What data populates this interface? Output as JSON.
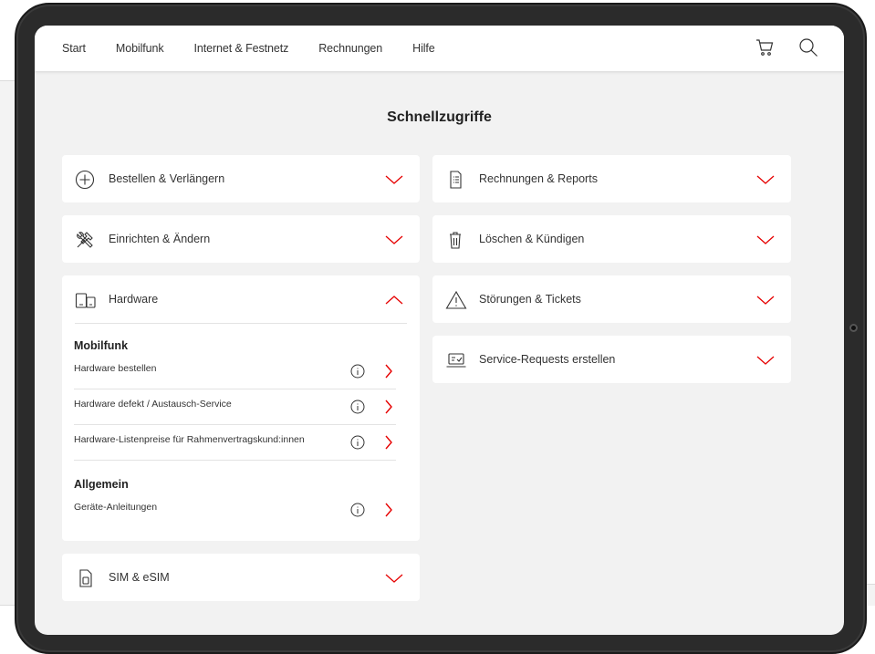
{
  "nav": {
    "items": [
      "Start",
      "Mobilfunk",
      "Internet & Festnetz",
      "Rechnungen",
      "Hilfe"
    ],
    "cart_icon": "cart-icon",
    "search_icon": "search-icon"
  },
  "page": {
    "title": "Schnellzugriffe"
  },
  "cards": {
    "bestellen": {
      "label": "Bestellen & Verlängern",
      "icon": "plus-circle-icon"
    },
    "einrichten": {
      "label": "Einrichten & Ändern",
      "icon": "tools-icon"
    },
    "hardware": {
      "label": "Hardware",
      "icon": "devices-icon",
      "groups": [
        {
          "title": "Mobilfunk",
          "links": [
            "Hardware bestellen",
            "Hardware defekt / Austausch-Service",
            "Hardware-Listenpreise für Rahmenvertragskund:innen"
          ]
        },
        {
          "title": "Allgemein",
          "links": [
            "Geräte-Anleitungen"
          ]
        }
      ]
    },
    "sim": {
      "label": "SIM & eSIM",
      "icon": "sim-card-icon"
    },
    "rechnungen": {
      "label": "Rechnungen & Reports",
      "icon": "document-icon"
    },
    "loeschen": {
      "label": "Löschen & Kündigen",
      "icon": "trash-icon"
    },
    "stoerungen": {
      "label": "Störungen & Tickets",
      "icon": "warning-icon"
    },
    "service": {
      "label": "Service-Requests erstellen",
      "icon": "laptop-icon"
    }
  },
  "colors": {
    "accent": "#e60000",
    "card_bg": "#ffffff",
    "page_bg": "#f2f2f2"
  }
}
